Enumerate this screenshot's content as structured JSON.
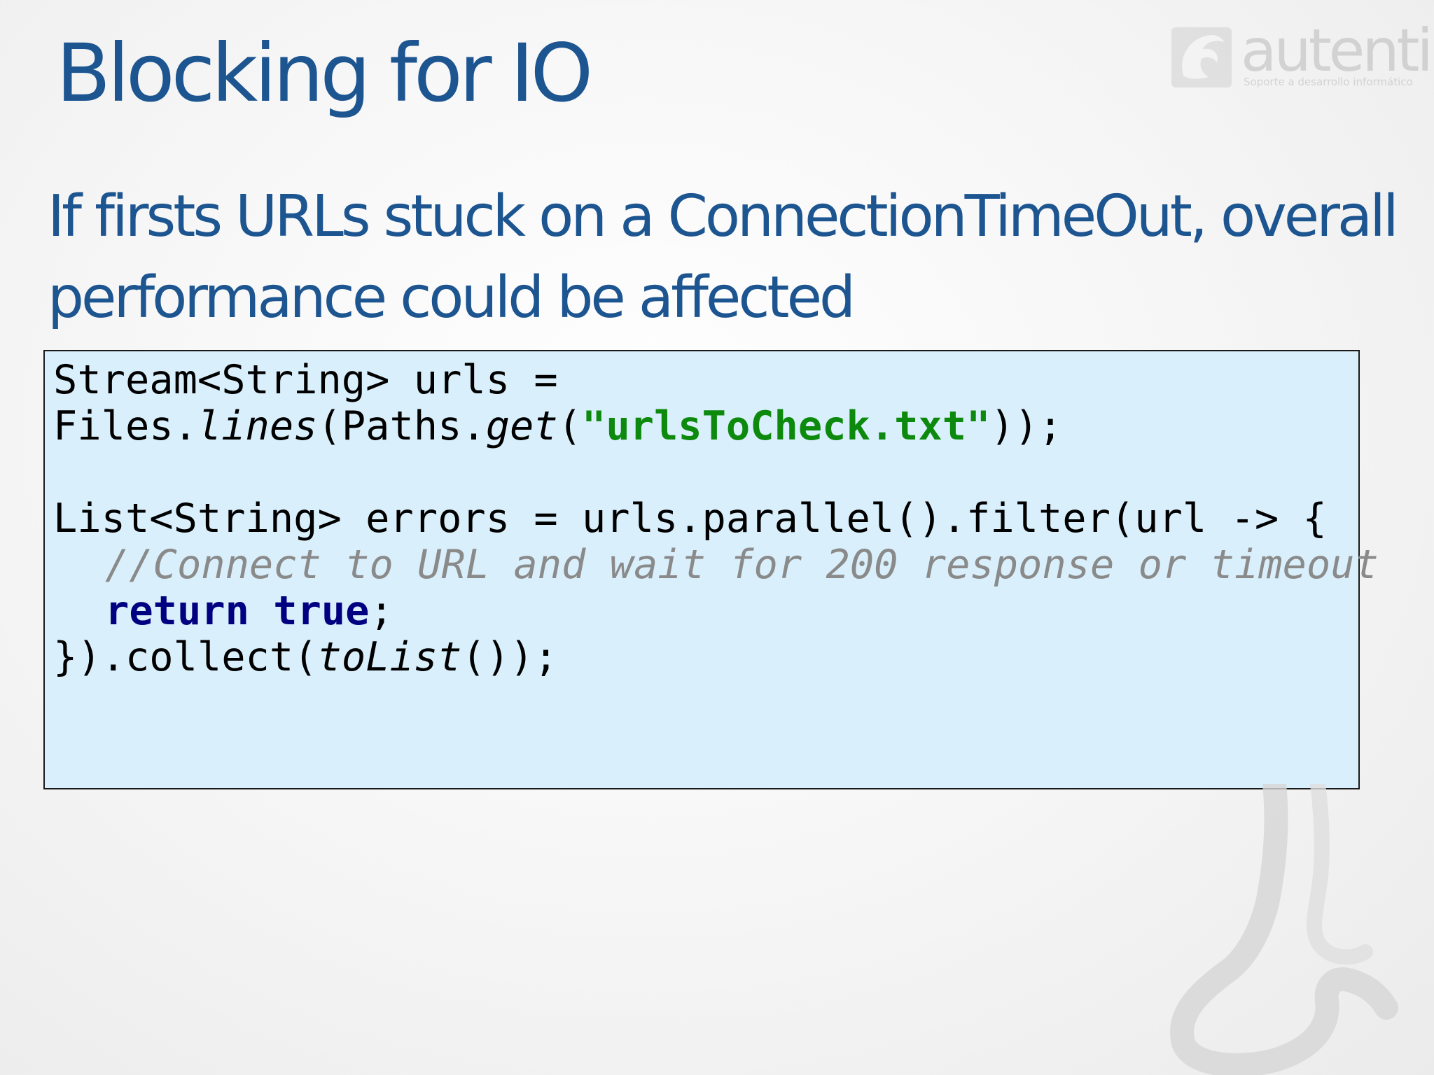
{
  "slide": {
    "title": "Blocking for IO",
    "subtitle": "If firsts URLs stuck on a ConnectionTimeOut, overall performance could be affected"
  },
  "logo": {
    "wordmark": "autentia",
    "tagline": "Soporte a desarrollo informático"
  },
  "code": {
    "line1": "Stream<String> urls =",
    "line2_a": "Files.",
    "line2_b": "lines",
    "line2_c": "(Paths.",
    "line2_d": "get",
    "line2_e": "(",
    "line2_str": "\"urlsToCheck.txt\"",
    "line2_f": "));",
    "line4": "List<String> errors = urls.parallel().filter(url -> {",
    "line5_comment": "//Connect to URL and wait for 200 response or timeout",
    "line6_kw1": "return",
    "line6_space": " ",
    "line6_kw2": "true",
    "line6_end": ";",
    "line7_a": "}).collect(",
    "line7_b": "toList",
    "line7_c": "());"
  },
  "colors": {
    "title": "#1d5591",
    "code_background": "#d9f0fc",
    "string": "#0d8a0d",
    "keyword": "#000080",
    "comment": "#8a8a8a"
  }
}
